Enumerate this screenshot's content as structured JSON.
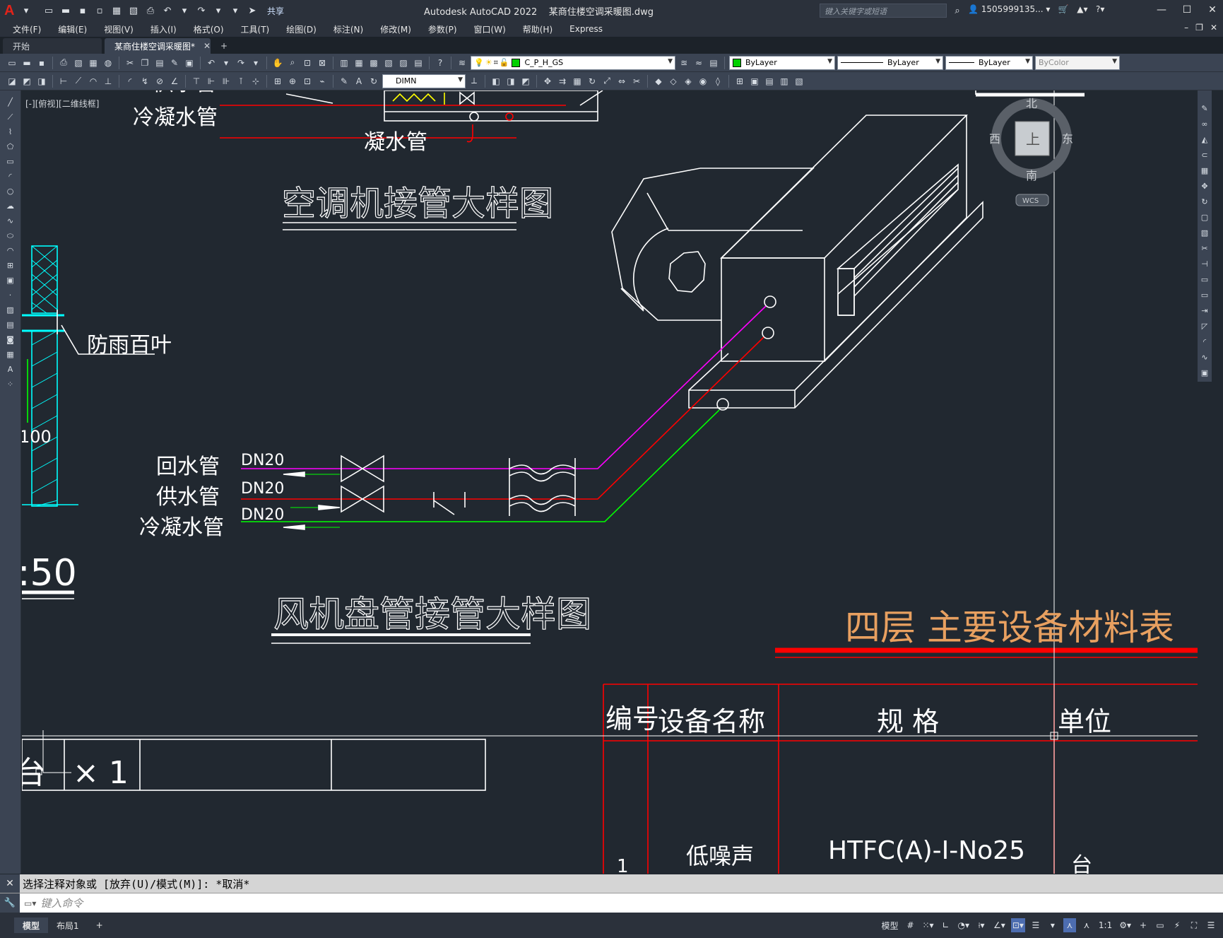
{
  "app": {
    "title": "Autodesk AutoCAD 2022",
    "filename": "某商住楼空调采暖图.dwg",
    "share_label": "共享",
    "search_placeholder": "键入关键字或短语",
    "user": "1505999135..."
  },
  "menu": [
    "文件(F)",
    "编辑(E)",
    "视图(V)",
    "插入(I)",
    "格式(O)",
    "工具(T)",
    "绘图(D)",
    "标注(N)",
    "修改(M)",
    "参数(P)",
    "窗口(W)",
    "帮助(H)",
    "Express"
  ],
  "file_tabs": [
    {
      "label": "开始",
      "active": false
    },
    {
      "label": "某商住楼空调采暖图*",
      "active": true
    }
  ],
  "toolbar": {
    "layer_name": "C_P_H_GS",
    "color": "ByLayer",
    "linetype": "ByLayer",
    "lineweight": "ByLayer",
    "plotstyle": "ByColor",
    "dimstyle": "DIMN"
  },
  "viewport_label": "[-][俯视][二维线框]",
  "viewcube": {
    "north": "北",
    "south": "南",
    "east": "东",
    "west": "西",
    "face": "上",
    "wcs": "WCS"
  },
  "drawing": {
    "top_labels": {
      "supply_pipe_partial": "供水管",
      "condensate_pipe": "冷凝水管",
      "condensate_short": "凝水管"
    },
    "ac_detail_title": "空调机接管大样图",
    "louver_label": "防雨百叶",
    "dim_100": "100",
    "scale_fragment": ":50",
    "pipes": {
      "return": {
        "label": "回水管",
        "size": "DN20"
      },
      "supply": {
        "label": "供水管",
        "size": "DN20"
      },
      "condensate": {
        "label": "冷凝水管",
        "size": "DN20"
      }
    },
    "fcu_detail_title": "风机盘管接管大样图",
    "material_table_title": "四层 主要设备材料表",
    "table": {
      "headers": [
        "编号",
        "设备名称",
        "规 格",
        "单位"
      ],
      "row1": {
        "no": "1",
        "name": "低噪声",
        "spec": "HTFC(A)-I-No25",
        "unit": "台"
      }
    },
    "bottom_left_fragment": "台",
    "bottom_qty": "× 1"
  },
  "command": {
    "history": "选择注释对象或 [放弃(U)/模式(M)]: *取消*",
    "placeholder": "键入命令"
  },
  "layout_tabs": [
    "模型",
    "布局1"
  ],
  "status": {
    "model_label": "模型",
    "scale": "1:1"
  },
  "colors": {
    "canvas_bg": "#212830",
    "ui_dark": "#2b313b",
    "ui_mid": "#3b4453",
    "line_white": "#ffffff",
    "line_red": "#ff0000",
    "line_magenta": "#ff00ff",
    "line_green": "#00ff00",
    "line_cyan": "#00ffff",
    "title_orange": "#e8a060"
  }
}
